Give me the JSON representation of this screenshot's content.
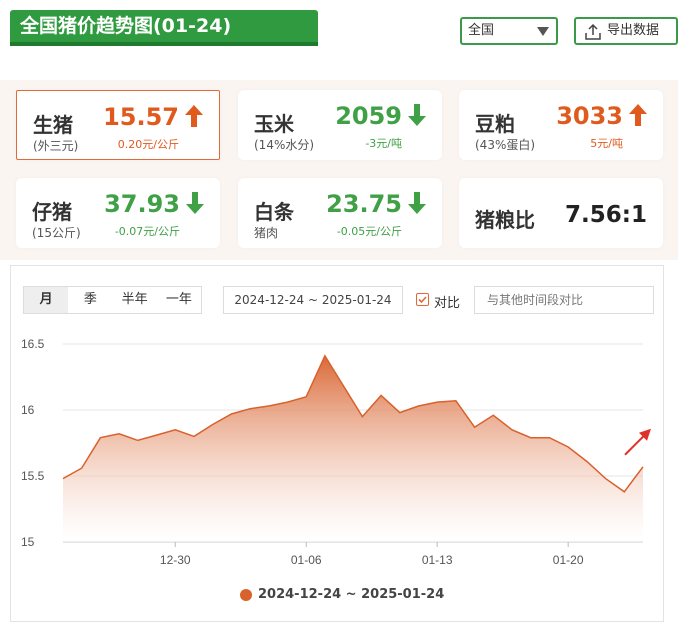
{
  "header": {
    "title": "全国猪价趋势图(01-24)",
    "region": "全国",
    "export_label": "导出数据"
  },
  "cards": [
    {
      "name": "生猪",
      "sub": "(外三元)",
      "price": "15.57",
      "change": "0.20元/公斤",
      "trend": "up"
    },
    {
      "name": "玉米",
      "sub": "(14%水分)",
      "price": "2059",
      "change": "-3元/吨",
      "trend": "down"
    },
    {
      "name": "豆粕",
      "sub": "(43%蛋白)",
      "price": "3033",
      "change": "5元/吨",
      "trend": "up"
    },
    {
      "name": "仔猪",
      "sub": "(15公斤)",
      "price": "37.93",
      "change": "-0.07元/公斤",
      "trend": "down"
    },
    {
      "name": "白条",
      "sub": "猪肉",
      "price": "23.75",
      "change": "-0.05元/公斤",
      "trend": "down"
    },
    {
      "name": "猪粮比",
      "value": "7.56:1"
    }
  ],
  "controls": {
    "periods": [
      "月",
      "季",
      "半年",
      "一年"
    ],
    "selected_period": "月",
    "date_range": "2024-12-24 ~ 2025-01-24",
    "compare_label": "对比",
    "compare_placeholder": "与其他时间段对比"
  },
  "colors": {
    "brand_green": "#2f9a3f",
    "up": "#e05a1e",
    "down": "#3fa046",
    "series": "#d8612c"
  },
  "chart_data": {
    "type": "area",
    "x": [
      "2024-12-24",
      "2024-12-25",
      "2024-12-26",
      "2024-12-27",
      "2024-12-28",
      "2024-12-29",
      "2024-12-30",
      "2024-12-31",
      "2025-01-01",
      "2025-01-02",
      "2025-01-03",
      "2025-01-04",
      "2025-01-05",
      "2025-01-06",
      "2025-01-07",
      "2025-01-08",
      "2025-01-09",
      "2025-01-10",
      "2025-01-11",
      "2025-01-12",
      "2025-01-13",
      "2025-01-14",
      "2025-01-15",
      "2025-01-16",
      "2025-01-17",
      "2025-01-18",
      "2025-01-19",
      "2025-01-20",
      "2025-01-21",
      "2025-01-22",
      "2025-01-23",
      "2025-01-24"
    ],
    "xticks": [
      "12-30",
      "01-06",
      "01-13",
      "01-20"
    ],
    "xtick_dates": [
      "2024-12-30",
      "2025-01-06",
      "2025-01-13",
      "2025-01-20"
    ],
    "series": [
      {
        "name": "2024-12-24 ~ 2025-01-24",
        "values": [
          15.48,
          15.56,
          15.79,
          15.82,
          15.77,
          15.81,
          15.85,
          15.8,
          15.89,
          15.97,
          16.01,
          16.03,
          16.06,
          16.1,
          16.41,
          16.18,
          15.95,
          16.11,
          15.98,
          16.03,
          16.06,
          16.07,
          15.87,
          15.96,
          15.85,
          15.79,
          15.79,
          15.72,
          15.61,
          15.48,
          15.38,
          15.57
        ]
      }
    ],
    "ylim": [
      15,
      16.5
    ],
    "yticks": [
      15,
      15.5,
      16,
      16.5
    ],
    "grid": true,
    "legend": "bottom"
  }
}
